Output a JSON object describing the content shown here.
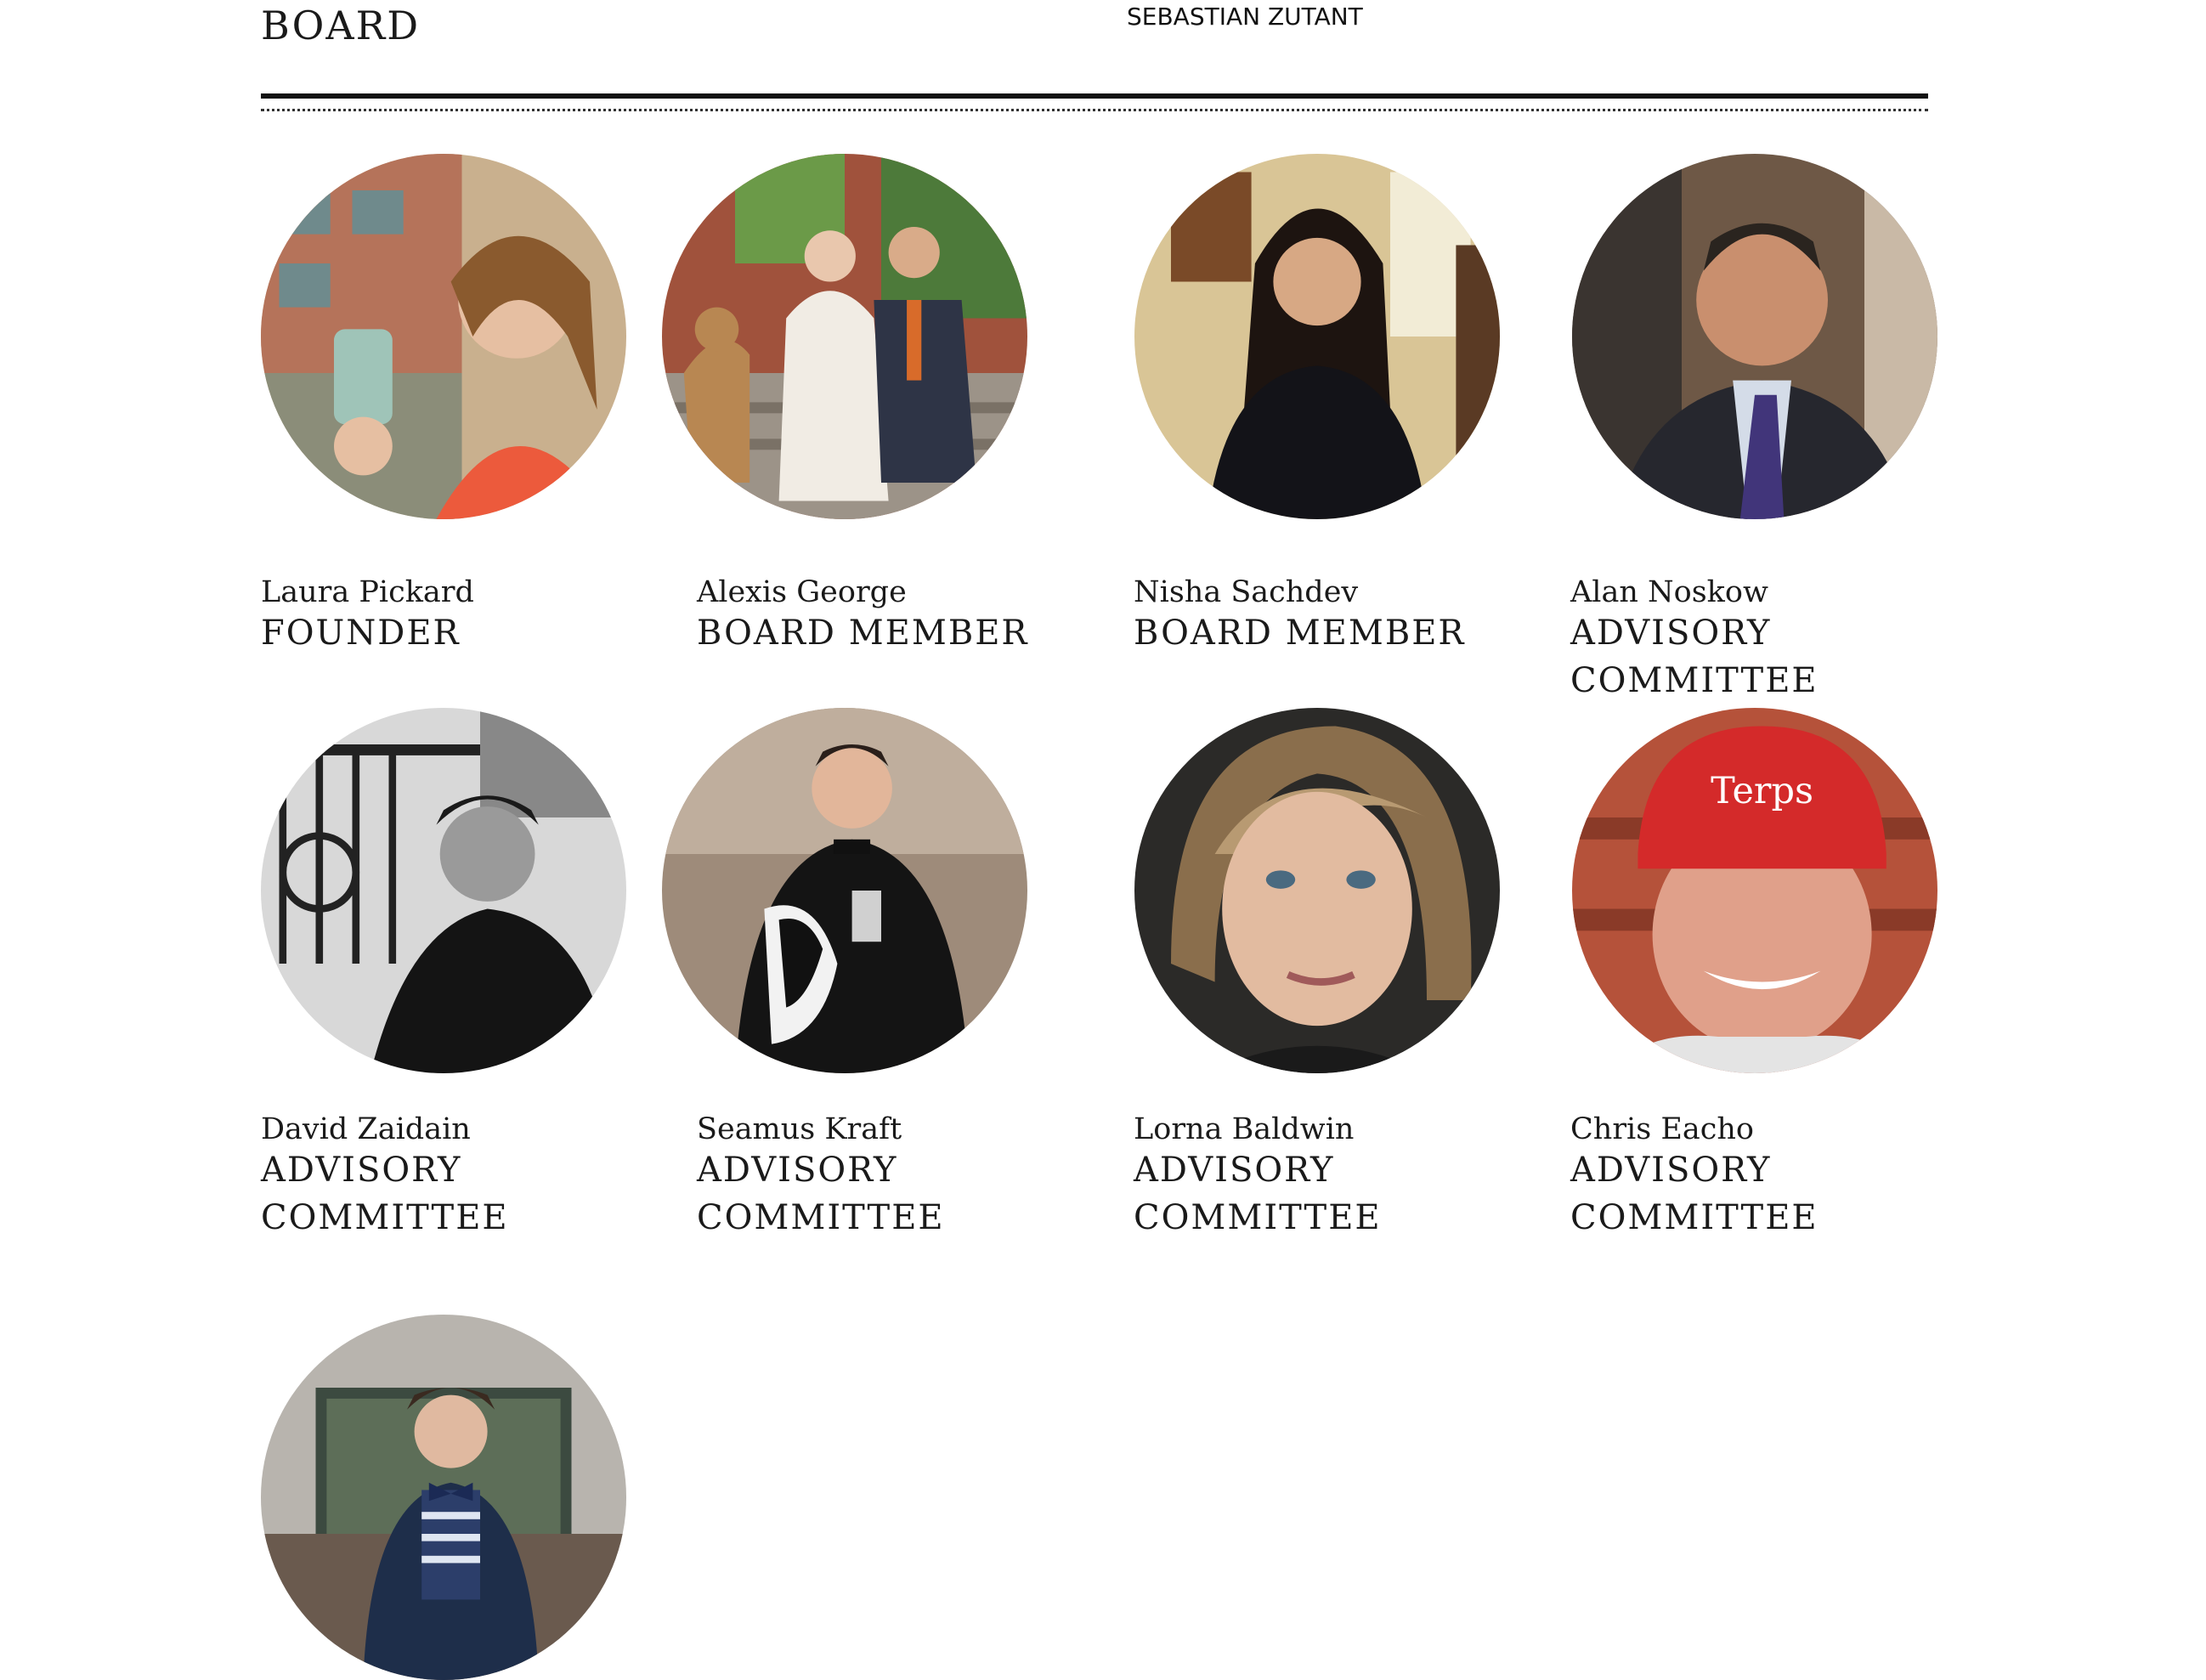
{
  "header": {
    "section_title": "BOARD",
    "credit": "SEBASTIAN ZUTANT"
  },
  "members": [
    {
      "name": "Laura Pickard",
      "role": "FOUNDER",
      "photo_icon": "portrait-photo"
    },
    {
      "name": "Alexis George",
      "role": "BOARD MEMBER",
      "photo_icon": "portrait-photo"
    },
    {
      "name": "Nisha Sachdev",
      "role": "BOARD MEMBER",
      "photo_icon": "portrait-photo"
    },
    {
      "name": "Alan Noskow",
      "role": "ADVISORY COMMITTEE",
      "photo_icon": "portrait-photo"
    },
    {
      "name": "David Zaidain",
      "role": "ADVISORY COMMITTEE",
      "photo_icon": "portrait-photo"
    },
    {
      "name": "Seamus Kraft",
      "role": "ADVISORY COMMITTEE",
      "photo_icon": "portrait-photo"
    },
    {
      "name": "Lorna Baldwin",
      "role": "ADVISORY COMMITTEE",
      "photo_icon": "portrait-photo"
    },
    {
      "name": "Chris Eacho",
      "role": "ADVISORY COMMITTEE",
      "photo_icon": "portrait-photo"
    }
  ],
  "extra_photo": {
    "photo_icon": "portrait-photo"
  },
  "colors": {
    "text": "#1a1a1a",
    "rule": "#111111"
  }
}
